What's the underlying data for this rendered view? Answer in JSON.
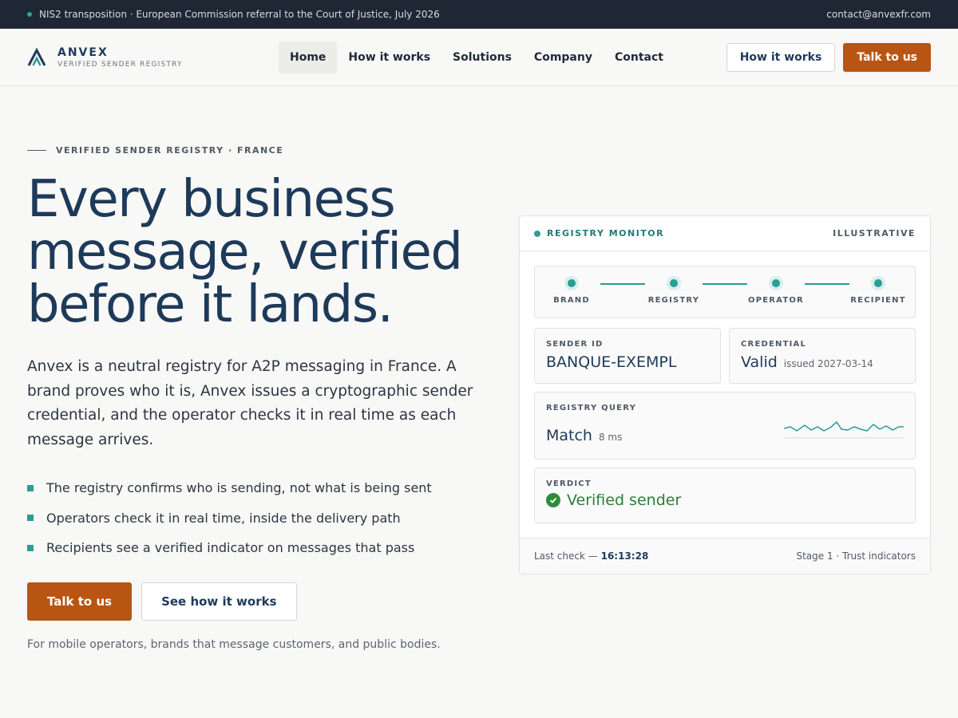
{
  "topbar": {
    "announcement": "NIS2 transposition · European Commission referral to the Court of Justice, July 2026",
    "email": "contact@anvexfr.com"
  },
  "brand": {
    "name": "ANVEX",
    "tagline": "VERIFIED SENDER REGISTRY",
    "color": "#1e3a5a"
  },
  "nav": {
    "items": [
      {
        "label": "Home",
        "active": true
      },
      {
        "label": "How it works"
      },
      {
        "label": "Solutions"
      },
      {
        "label": "Company"
      },
      {
        "label": "Contact"
      }
    ]
  },
  "header_actions": {
    "secondary": "How it works",
    "primary": "Talk to us"
  },
  "hero": {
    "eyebrow": "VERIFIED SENDER REGISTRY · FRANCE",
    "headline": [
      "Every business",
      "message, verified",
      "before it lands."
    ],
    "lede": "Anvex is a neutral registry for A2P messaging in France. A brand proves who it is, Anvex issues a cryptographic sender credential, and the operator checks it in real time as each message arrives.",
    "bullets": [
      "The registry confirms who is sending, not what is being sent",
      "Operators check it in real time, inside the delivery path",
      "Recipients see a verified indicator on messages that pass"
    ],
    "cta_primary": "Talk to us",
    "cta_secondary": "See how it works",
    "footnote": "For mobile operators, brands that message customers, and public bodies."
  },
  "monitor": {
    "title": "REGISTRY MONITOR",
    "tag": "ILLUSTRATIVE",
    "stages": [
      "BRAND",
      "REGISTRY",
      "OPERATOR",
      "RECIPIENT"
    ],
    "sender_id": {
      "label": "SENDER ID",
      "value": "BANQUE-EXEMPL"
    },
    "credential": {
      "label": "CREDENTIAL",
      "value": "Valid",
      "detail": "issued 2027-03-14"
    },
    "query": {
      "label": "REGISTRY QUERY",
      "value": "Match",
      "detail": "8 ms"
    },
    "verdict": {
      "label": "VERDICT",
      "value": "Verified sender"
    },
    "footer": {
      "last_check_label": "Last check —",
      "last_check_time": "16:13:28",
      "stage": "Stage 1 · Trust indicators"
    }
  },
  "colors": {
    "accent": "#2a9d94",
    "cta": "#b85513",
    "success": "#2e7d3a",
    "topbar": "#1e2733"
  }
}
